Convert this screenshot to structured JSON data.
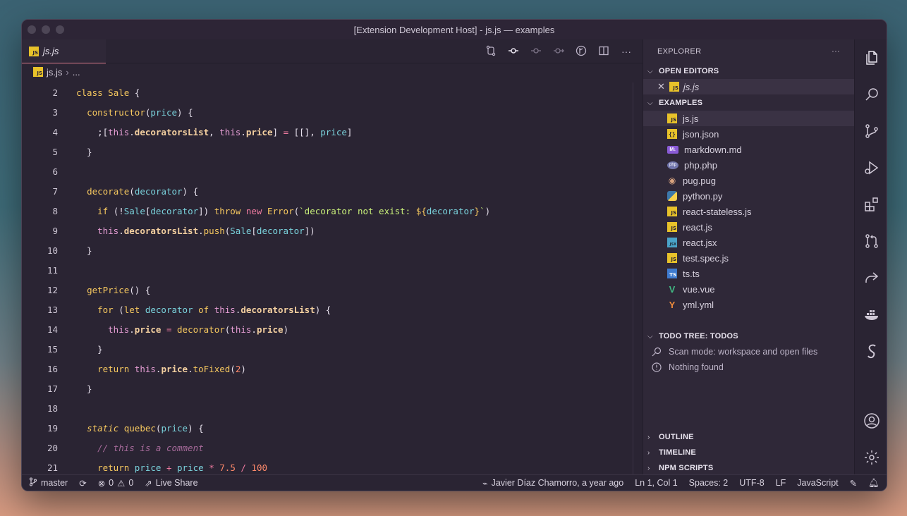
{
  "window": {
    "title": "[Extension Development Host] - js.js — examples"
  },
  "tab": {
    "label": "js.js",
    "icon": "js-file-icon"
  },
  "breadcrumb": {
    "file": "js.js",
    "rest": "..."
  },
  "code": {
    "line_numbers": [
      "2",
      "3",
      "4",
      "5",
      "6",
      "7",
      "8",
      "9",
      "10",
      "11",
      "12",
      "13",
      "14",
      "15",
      "16",
      "17",
      "18",
      "19",
      "20",
      "21"
    ]
  },
  "explorer": {
    "header": "EXPLORER",
    "more": "···",
    "open_editors_label": "OPEN EDITORS",
    "open_editor_file": "js.js",
    "examples_label": "EXAMPLES",
    "files": [
      {
        "name": "js.js",
        "icon": "js-file-icon"
      },
      {
        "name": "json.json",
        "icon": "json-file-icon"
      },
      {
        "name": "markdown.md",
        "icon": "markdown-file-icon"
      },
      {
        "name": "php.php",
        "icon": "php-file-icon"
      },
      {
        "name": "pug.pug",
        "icon": "pug-file-icon"
      },
      {
        "name": "python.py",
        "icon": "python-file-icon"
      },
      {
        "name": "react-stateless.js",
        "icon": "js-file-icon"
      },
      {
        "name": "react.js",
        "icon": "js-file-icon"
      },
      {
        "name": "react.jsx",
        "icon": "jsx-file-icon"
      },
      {
        "name": "test.spec.js",
        "icon": "js-file-icon"
      },
      {
        "name": "ts.ts",
        "icon": "ts-file-icon"
      },
      {
        "name": "vue.vue",
        "icon": "vue-file-icon"
      },
      {
        "name": "yml.yml",
        "icon": "yaml-file-icon"
      }
    ],
    "todo_label": "TODO TREE: TODOS",
    "todo_scan": "Scan mode: workspace and open files",
    "todo_empty": "Nothing found",
    "outline_label": "OUTLINE",
    "timeline_label": "TIMELINE",
    "npm_label": "NPM SCRIPTS"
  },
  "status": {
    "branch": "master",
    "errors": "0",
    "warnings": "0",
    "live_share": "Live Share",
    "blame": "Javier Díaz Chamorro, a year ago",
    "position": "Ln 1, Col 1",
    "spaces": "Spaces: 2",
    "encoding": "UTF-8",
    "eol": "LF",
    "language": "JavaScript"
  },
  "colors": {
    "background": "#2a2433",
    "sidebar": "#2f2838",
    "keyword": "#f6c85f",
    "parameter": "#7ad2dc",
    "string": "#c9f07a",
    "number": "#ff8a6b",
    "comment": "#a66a9a",
    "this": "#e59dd4",
    "tab_accent": "#d77a8b"
  }
}
